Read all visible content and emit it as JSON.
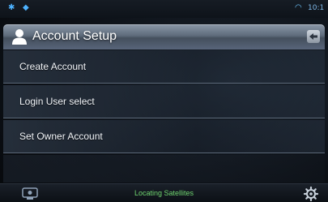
{
  "status_bar": {
    "bluetooth_icon": "bluetooth-icon",
    "location_icon": "location-icon",
    "wifi_icon": "wifi-icon",
    "time": "10:1"
  },
  "header": {
    "icon": "user-icon",
    "title": "Account Setup",
    "back_icon": "back-icon"
  },
  "menu": {
    "items": [
      {
        "label": "Create Account"
      },
      {
        "label": "Login User select"
      },
      {
        "label": "Set Owner Account"
      }
    ]
  },
  "bottom_bar": {
    "left_icon": "media-icon",
    "status": "Locating Satellites",
    "right_icon": "settings-gear-icon"
  },
  "colors": {
    "header_top": "#8b98a8",
    "status_green": "#6fd46f",
    "accent_blue": "#4db2ff"
  }
}
